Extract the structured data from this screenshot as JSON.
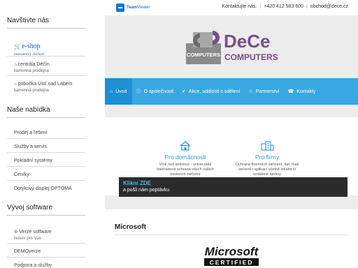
{
  "sidebar": {
    "visit_heading": "Navštivte nás",
    "eshop": {
      "label": "e-shop",
      "sublabel": "internetový obchod",
      "icon": "cart-icon"
    },
    "locations": [
      {
        "label": "centrála Děčín",
        "sub": "kamenná prodejna",
        "icon": "home-icon"
      },
      {
        "label": "pobočka Ústí nad Labem",
        "sub": "kamenná prodejna",
        "icon": "home-icon"
      }
    ],
    "offer_heading": "Naše nabídka",
    "offer_items": [
      "Prodej a řešení",
      "Služby a servis",
      "Pokladní systémy",
      "Ceníky",
      "Dotykový displej OPTOMA"
    ],
    "dev_heading": "Vývoj software",
    "dev_items": [
      {
        "label": "Verze software",
        "sub": "řešení pro Vás",
        "icon": "wrench-icon"
      },
      {
        "label": "DEMOverze",
        "sub": ""
      },
      {
        "label": "Podpora a služby",
        "sub": ""
      }
    ]
  },
  "topbar": {
    "teamviewer_brand": "Team",
    "teamviewer_brand2": "Viewer",
    "contact_label": "Kontaktujte nás:",
    "phone": "+420 412 583 600",
    "email": "obchod@dece.cz"
  },
  "logo": {
    "left_text": "COMPUTERS",
    "brand": "DeCe",
    "brand_sub": "COMPUTERS"
  },
  "nav": {
    "items": [
      {
        "label": "Úvod",
        "icon": "home-icon",
        "active": true
      },
      {
        "label": "O společnosti",
        "icon": "info-icon"
      },
      {
        "label": "Akce, události s sdělení",
        "icon": "thumbs-up-icon"
      },
      {
        "label": "Partnerství",
        "icon": "handshake-icon"
      },
      {
        "label": "Kontakty",
        "icon": "phone-icon"
      }
    ]
  },
  "services": [
    {
      "title": "Pro domácnosti",
      "desc": "Více než antivirus - univerzální internetová ochrana všech vašich osobních zařízení",
      "icon": "house-icon"
    },
    {
      "title": "Pro firmy",
      "desc": "Ochrana firemních zařízení, dat, mail serverů i aplikací včetně lokální či vzdálené správy",
      "icon": "buildings-icon"
    }
  ],
  "cta": {
    "title": "Klikni ZDE",
    "subtitle": "a pošli nám poptávku"
  },
  "microsoft_section": {
    "title": "Microsoft",
    "logo_word": "Microsoft",
    "logo_sub": "CERTIFIED"
  },
  "colors": {
    "accent": "#3aa8e0",
    "accent_dark": "#1e8fd0",
    "link_blue": "#1a5fa8",
    "logo_purple": "#7a4e86"
  }
}
